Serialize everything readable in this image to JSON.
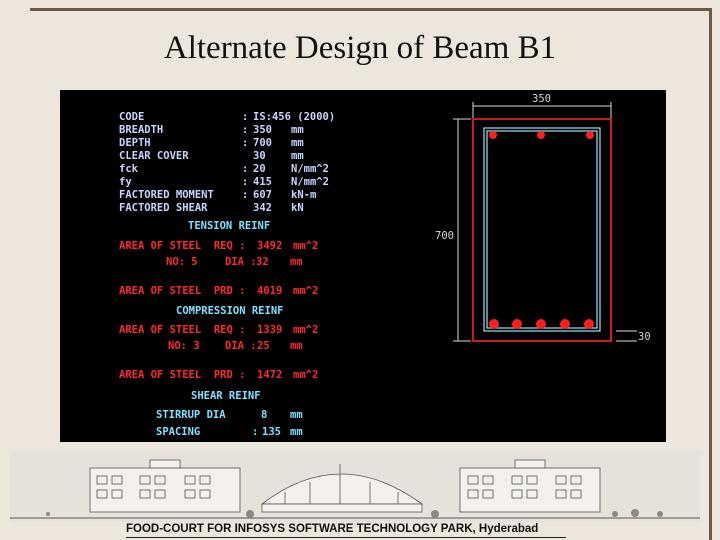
{
  "slide": {
    "title": "Alternate Design of Beam B1",
    "footer": "FOOD-COURT FOR INFOSYS SOFTWARE TECHNOLOGY PARK, Hyderabad"
  },
  "design": {
    "code": {
      "label": "CODE",
      "value": "IS:456 (2000)"
    },
    "breadth": {
      "label": "BREADTH",
      "value": "350",
      "unit": "mm"
    },
    "depth": {
      "label": "DEPTH",
      "value": "700",
      "unit": "mm"
    },
    "cover": {
      "label": "CLEAR COVER",
      "value": "30",
      "unit": "mm"
    },
    "fck": {
      "label": "fck",
      "value": "20",
      "unit": "N/mm^2"
    },
    "fy": {
      "label": "fy",
      "value": "415",
      "unit": "N/mm^2"
    },
    "moment": {
      "label": "FACTORED MOMENT",
      "value": "607",
      "unit": "kN-m"
    },
    "shear": {
      "label": "FACTORED SHEAR",
      "value": "342",
      "unit": "kN"
    },
    "tension": {
      "heading": "TENSION REINF",
      "req_label": "AREA OF STEEL  REQ :",
      "req_value": "3492",
      "req_unit": "mm^2",
      "no_label": "NO: 5",
      "dia_label": "DIA :",
      "dia_value": "32",
      "dia_unit": "mm",
      "prd_label": "AREA OF STEEL  PRD :",
      "prd_value": "4019",
      "prd_unit": "mm^2"
    },
    "compression": {
      "heading": "COMPRESSION REINF",
      "req_label": "AREA OF STEEL  REQ :",
      "req_value": "1339",
      "req_unit": "mm^2",
      "no_label": "NO: 3",
      "dia_label": "DIA :",
      "dia_value": "25",
      "dia_unit": "mm",
      "prd_label": "AREA OF STEEL  PRD :",
      "prd_value": "1472",
      "prd_unit": "mm^2"
    },
    "shear_reinf": {
      "heading": "SHEAR REINF",
      "stirrup_label": "STIRRUP DIA",
      "stirrup_value": "8",
      "stirrup_unit": "mm",
      "spacing_label": "SPACING",
      "spacing_value": "135",
      "spacing_unit": "mm"
    }
  },
  "drawing": {
    "width_dim": "350",
    "depth_dim": "700",
    "cover_dim": "30",
    "colors": {
      "bar": "#ff1f1f",
      "outline": "#ff2a2a",
      "stirrup": "#8fe6ff",
      "dim": "#d8d8d8"
    }
  }
}
